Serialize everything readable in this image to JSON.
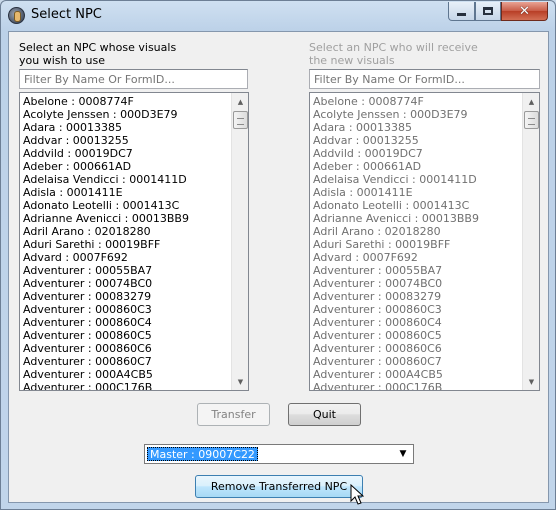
{
  "window": {
    "title": "Select NPC"
  },
  "left": {
    "label_line1": "Select an NPC whose visuals",
    "label_line2": "you wish to use",
    "filter_placeholder": "Filter By Name Or FormID...",
    "items": [
      "Abelone : 0008774F",
      "Acolyte Jenssen : 000D3E79",
      "Adara : 00013385",
      "Addvar : 00013255",
      "Addvild : 00019DC7",
      "Adeber : 000661AD",
      "Adelaisa Vendicci : 0001411D",
      "Adisla : 0001411E",
      "Adonato Leotelli : 0001413C",
      "Adrianne Avenicci : 00013BB9",
      "Adril Arano : 02018280",
      "Aduri Sarethi : 00019BFF",
      "Advard : 0007F692",
      "Adventurer : 00055BA7",
      "Adventurer : 00074BC0",
      "Adventurer : 00083279",
      "Adventurer : 000860C3",
      "Adventurer : 000860C4",
      "Adventurer : 000860C5",
      "Adventurer : 000860C6",
      "Adventurer : 000860C7",
      "Adventurer : 000A4CB5",
      "Adventurer : 000C176B"
    ]
  },
  "right": {
    "label_line1": "Select an NPC who will receive",
    "label_line2": "the new visuals",
    "filter_placeholder": "Filter By Name Or FormID...",
    "items": [
      "Abelone : 0008774F",
      "Acolyte Jenssen : 000D3E79",
      "Adara : 00013385",
      "Addvar : 00013255",
      "Addvild : 00019DC7",
      "Adeber : 000661AD",
      "Adelaisa Vendicci : 0001411D",
      "Adisla : 0001411E",
      "Adonato Leotelli : 0001413C",
      "Adrianne Avenicci : 00013BB9",
      "Adril Arano : 02018280",
      "Aduri Sarethi : 00019BFF",
      "Advard : 0007F692",
      "Adventurer : 00055BA7",
      "Adventurer : 00074BC0",
      "Adventurer : 00083279",
      "Adventurer : 000860C3",
      "Adventurer : 000860C4",
      "Adventurer : 000860C5",
      "Adventurer : 000860C6",
      "Adventurer : 000860C7",
      "Adventurer : 000A4CB5",
      "Adventurer : 000C176B"
    ]
  },
  "buttons": {
    "transfer": "Transfer",
    "quit": "Quit",
    "remove": "Remove Transferred NPC"
  },
  "master_combo": {
    "selected": "Master : 09007C22"
  },
  "icons": {
    "close": "close-icon",
    "minimize": "minimize-icon",
    "maximize": "maximize-icon",
    "app": "app-icon"
  }
}
